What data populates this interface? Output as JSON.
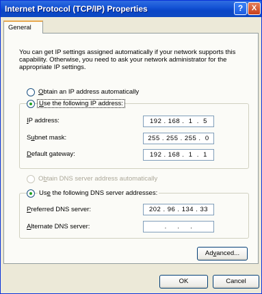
{
  "window": {
    "title": "Internet Protocol (TCP/IP) Properties",
    "help_glyph": "?",
    "close_glyph": "X"
  },
  "tabs": [
    {
      "label": "General",
      "selected": true
    }
  ],
  "description": "You can get IP settings assigned automatically if your network supports this capability. Otherwise, you need to ask your network administrator for the appropriate IP settings.",
  "ip_section": {
    "auto_option": {
      "label": "Obtain an IP address automatically",
      "selected": false
    },
    "manual_option": {
      "label": "Use the following IP address:",
      "selected": true
    },
    "fields": [
      {
        "label": "IP address:",
        "value": "192 . 168 .  1  .  5"
      },
      {
        "label": "Subnet mask:",
        "value": "255 . 255 . 255 .  0"
      },
      {
        "label": "Default gateway:",
        "value": "192 . 168 .  1  .  1"
      }
    ]
  },
  "dns_section": {
    "auto_option": {
      "label": "Obtain DNS server address automatically",
      "selected": false,
      "disabled": true
    },
    "manual_option": {
      "label": "Use the following DNS server addresses:",
      "selected": true
    },
    "fields": [
      {
        "label": "Preferred DNS server:",
        "value": "202 . 96 . 134 . 33"
      },
      {
        "label": "Alternate DNS server:",
        "value": "  .     .     .  "
      }
    ]
  },
  "buttons": {
    "advanced": "Advanced...",
    "ok": "OK",
    "cancel": "Cancel"
  },
  "colors": {
    "titlebar": "#0a45c7",
    "dialog_bg": "#ece9d8",
    "tab_highlight": "#e8a94f",
    "radio_dot": "#21a121"
  }
}
